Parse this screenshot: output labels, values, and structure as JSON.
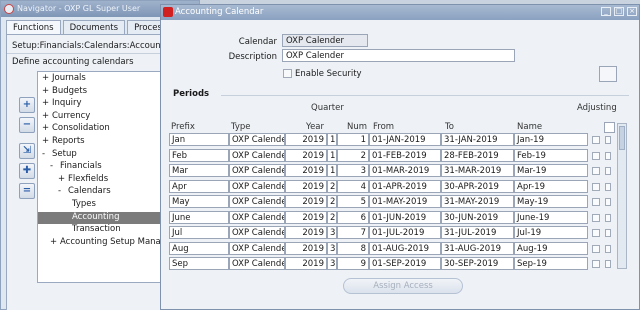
{
  "navigator": {
    "title": "Navigator - OXP GL Super User",
    "tabs": [
      "Functions",
      "Documents",
      "Processes"
    ],
    "path": "Setup:Financials:Calendars:Accounting",
    "description": "Define accounting calendars",
    "tree": [
      {
        "indent": 0,
        "prefix": "+",
        "label": "Journals"
      },
      {
        "indent": 0,
        "prefix": "+",
        "label": "Budgets"
      },
      {
        "indent": 0,
        "prefix": "+",
        "label": "Inquiry"
      },
      {
        "indent": 0,
        "prefix": "+",
        "label": "Currency"
      },
      {
        "indent": 0,
        "prefix": "+",
        "label": "Consolidation"
      },
      {
        "indent": 0,
        "prefix": "+",
        "label": "Reports"
      },
      {
        "indent": 0,
        "prefix": "-",
        "label": "Setup"
      },
      {
        "indent": 1,
        "prefix": "-",
        "label": "Financials"
      },
      {
        "indent": 2,
        "prefix": "+",
        "label": "Flexfields"
      },
      {
        "indent": 2,
        "prefix": "-",
        "label": "Calendars"
      },
      {
        "indent": 3,
        "prefix": "",
        "label": "Types"
      },
      {
        "indent": 3,
        "prefix": "",
        "label": "Accounting",
        "selected": true
      },
      {
        "indent": 3,
        "prefix": "",
        "label": "Transaction"
      },
      {
        "indent": 1,
        "prefix": "+",
        "label": "Accounting Setup Manager"
      }
    ]
  },
  "calendar_window": {
    "title": "Accounting Calendar",
    "calendar_label": "Calendar",
    "calendar_value": "OXP Calender",
    "description_label": "Description",
    "description_value": "OXP Calender",
    "enable_security_label": "Enable Security",
    "periods_heading": "Periods",
    "quarter_label": "Quarter",
    "adjusting_label": "Adjusting",
    "columns": {
      "prefix": "Prefix",
      "type": "Type",
      "year": "Year",
      "num": "Num",
      "from": "From",
      "to": "To",
      "name": "Name"
    },
    "rows": [
      {
        "prefix": "Jan",
        "type": "OXP Calender",
        "year": "2019",
        "quarter": "1",
        "num": "1",
        "from": "01-JAN-2019",
        "to": "31-JAN-2019",
        "name": "Jan-19"
      },
      {
        "prefix": "Feb",
        "type": "OXP Calender",
        "year": "2019",
        "quarter": "1",
        "num": "2",
        "from": "01-FEB-2019",
        "to": "28-FEB-2019",
        "name": "Feb-19"
      },
      {
        "prefix": "Mar",
        "type": "OXP Calender",
        "year": "2019",
        "quarter": "1",
        "num": "3",
        "from": "01-MAR-2019",
        "to": "31-MAR-2019",
        "name": "Mar-19"
      },
      {
        "prefix": "Apr",
        "type": "OXP Calender",
        "year": "2019",
        "quarter": "2",
        "num": "4",
        "from": "01-APR-2019",
        "to": "30-APR-2019",
        "name": "Apr-19"
      },
      {
        "prefix": "May",
        "type": "OXP Calender",
        "year": "2019",
        "quarter": "2",
        "num": "5",
        "from": "01-MAY-2019",
        "to": "31-MAY-2019",
        "name": "May-19"
      },
      {
        "prefix": "June",
        "type": "OXP Calender",
        "year": "2019",
        "quarter": "2",
        "num": "6",
        "from": "01-JUN-2019",
        "to": "30-JUN-2019",
        "name": "June-19"
      },
      {
        "prefix": "Jul",
        "type": "OXP Calender",
        "year": "2019",
        "quarter": "3",
        "num": "7",
        "from": "01-JUL-2019",
        "to": "31-JUL-2019",
        "name": "Jul-19"
      },
      {
        "prefix": "Aug",
        "type": "OXP Calender",
        "year": "2019",
        "quarter": "3",
        "num": "8",
        "from": "01-AUG-2019",
        "to": "31-AUG-2019",
        "name": "Aug-19"
      },
      {
        "prefix": "Sep",
        "type": "OXP Calender",
        "year": "2019",
        "quarter": "3",
        "num": "9",
        "from": "01-SEP-2019",
        "to": "30-SEP-2019",
        "name": "Sep-19"
      }
    ],
    "assign_access_label": "Assign Access"
  }
}
